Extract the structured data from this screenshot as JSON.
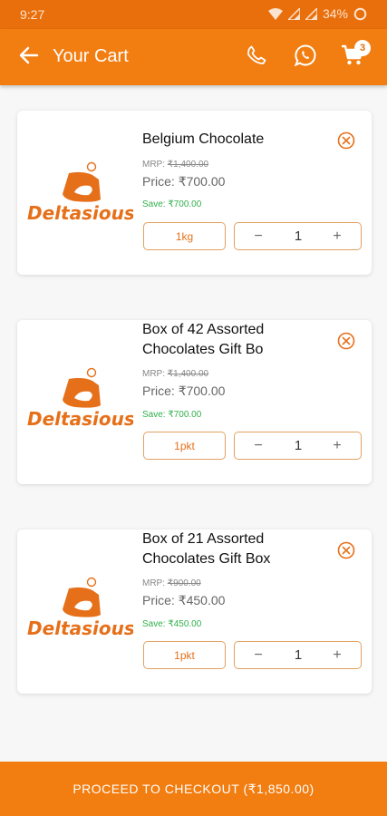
{
  "status_bar": {
    "time": "9:27",
    "battery": "34%"
  },
  "header": {
    "title": "Your Cart",
    "cart_count": "3"
  },
  "brand": {
    "logo_text": "Deltasious"
  },
  "colors": {
    "primary": "#f27d10",
    "save_green": "#2fb14a",
    "unit_border": "#e2a161"
  },
  "cart": {
    "items": [
      {
        "name": "Belgium Chocolate",
        "mrp_label": "MRP:",
        "mrp": "₹1,400.00",
        "price_label": "Price:",
        "price": "₹700.00",
        "save_label": "Save:",
        "save": "₹700.00",
        "unit": "1kg",
        "qty": "1"
      },
      {
        "name": "Box of 42 Assorted Chocolates Gift Bo",
        "mrp_label": "MRP:",
        "mrp": "₹1,400.00",
        "price_label": "Price:",
        "price": "₹700.00",
        "save_label": "Save:",
        "save": "₹700.00",
        "unit": "1pkt",
        "qty": "1"
      },
      {
        "name": "Box of 21 Assorted Chocolates Gift Box",
        "mrp_label": "MRP:",
        "mrp": "₹900.00",
        "price_label": "Price:",
        "price": "₹450.00",
        "save_label": "Save:",
        "save": "₹450.00",
        "unit": "1pkt",
        "qty": "1"
      }
    ]
  },
  "checkout": {
    "label": "PROCEED TO CHECKOUT (₹1,850.00)"
  },
  "icons": {
    "back": "arrow-left-icon",
    "phone": "phone-icon",
    "whatsapp": "whatsapp-icon",
    "cart": "cart-icon",
    "remove": "close-circle-icon",
    "minus": "minus-icon",
    "plus": "plus-icon"
  }
}
